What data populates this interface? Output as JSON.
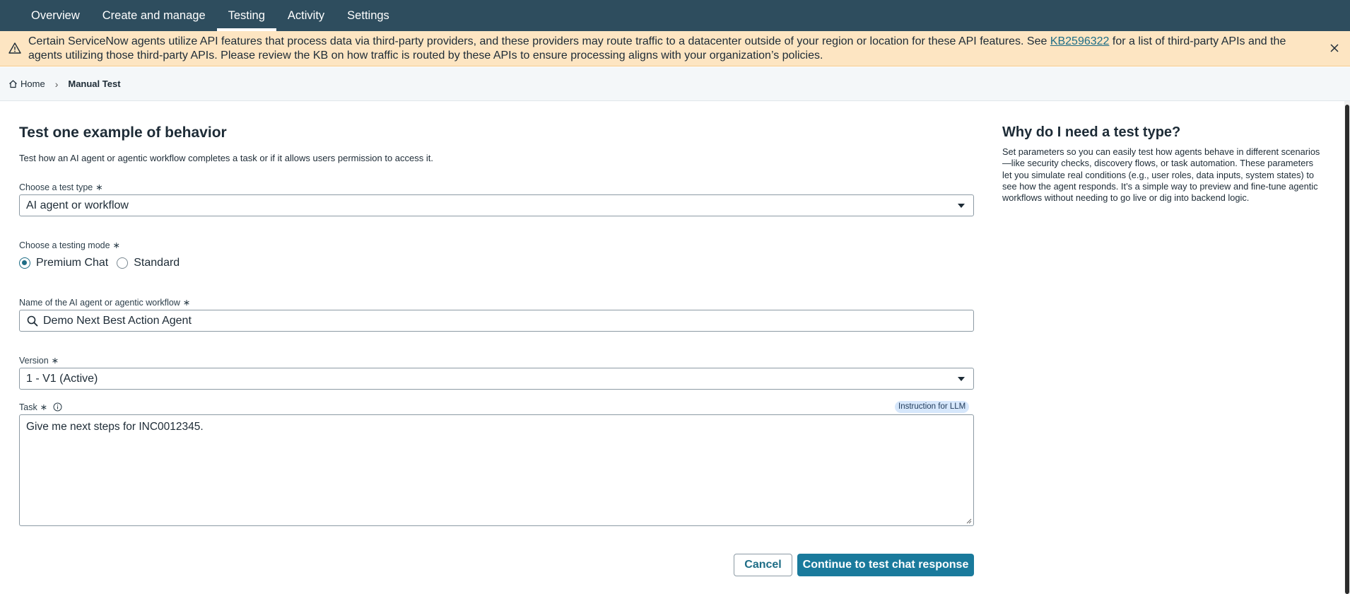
{
  "nav": {
    "tabs": [
      {
        "label": "Overview"
      },
      {
        "label": "Create and manage"
      },
      {
        "label": "Testing"
      },
      {
        "label": "Activity"
      },
      {
        "label": "Settings"
      }
    ],
    "active_tab": "Testing"
  },
  "banner": {
    "text_before": "Certain ServiceNow agents utilize API features that process data via third-party providers, and these providers may route traffic to a datacenter outside of your region or location for these API features. See ",
    "link": "KB2596322",
    "text_after": " for a list of third-party APIs and the agents utilizing those third-party APIs. Please review the KB on how traffic is routed by these APIs to ensure processing aligns with your organization’s policies.",
    "icon": "warning-icon",
    "close_icon": "close-icon"
  },
  "breadcrumb": {
    "home": "Home",
    "current": "Manual Test"
  },
  "form": {
    "title": "Test one example of behavior",
    "subtitle": "Test how an AI agent or agentic workflow completes a task or if it allows users permission to access it.",
    "test_type_label": "Choose a test type",
    "test_type_value": "AI agent or workflow",
    "mode_label": "Choose a testing mode",
    "mode_options": [
      "Premium Chat",
      "Standard"
    ],
    "mode_selected": "Premium Chat",
    "agent_label": "Name of the AI agent or agentic workflow",
    "agent_value": "Demo Next Best Action Agent",
    "version_label": "Version",
    "version_value": "1 - V1 (Active)",
    "task_label": "Task",
    "task_badge": "Instruction for LLM",
    "task_value": "Give me next steps for INC0012345.",
    "required_mark": "∗",
    "cancel_label": "Cancel",
    "continue_label": "Continue to test chat response"
  },
  "side": {
    "title": "Why do I need a test type?",
    "body": "Set parameters so you can easily test how agents behave in different scenarios—like security checks, discovery flows, or task automation. These parameters let you simulate real conditions (e.g., user roles, data inputs, system states) to see how the agent responds. It’s a simple way to preview and fine-tune agentic workflows without needing to go live or dig into backend logic."
  },
  "colors": {
    "nav_bg": "#2e4d5e",
    "banner_bg": "#fde5c2",
    "primary": "#1a7a9c",
    "link": "#1e6d86"
  }
}
